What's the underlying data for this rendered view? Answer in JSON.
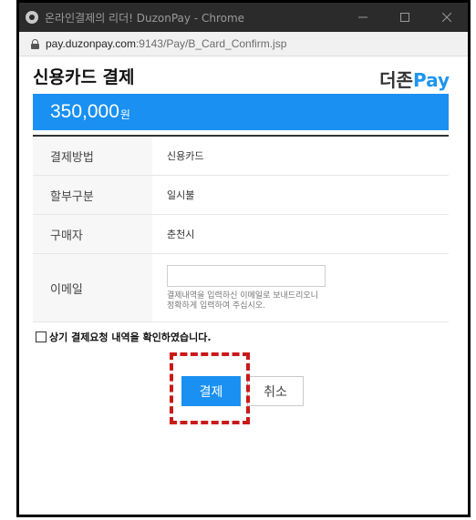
{
  "window": {
    "title": "온라인결제의 리더! DuzonPay - Chrome",
    "controls": {
      "minimize": "—",
      "maximize": "☐",
      "close": "✕"
    }
  },
  "url": {
    "host": "pay.duzonpay.com",
    "rest": ":9143/Pay/B_Card_Confirm.jsp"
  },
  "header": {
    "title": "신용카드 결제",
    "brand_korean": "더존",
    "brand_pay": "Pay"
  },
  "amount": {
    "value": "350,000",
    "unit": "원"
  },
  "details": {
    "rows": [
      {
        "label": "결제방법",
        "value": "신용카드"
      },
      {
        "label": "할부구분",
        "value": "일시불"
      },
      {
        "label": "구매자",
        "value": "춘천시"
      }
    ],
    "email": {
      "label": "이메일",
      "value": "",
      "placeholder": "",
      "help_line1": "결제내역을 입력하신 이메일로 보내드리오니",
      "help_line2": "정확하게 입력하여 주십시오."
    }
  },
  "confirm": {
    "text": "상기 결제요청 내역을 확인하였습니다.",
    "checked": false
  },
  "actions": {
    "pay_label": "결제",
    "cancel_label": "취소"
  },
  "colors": {
    "accent": "#1990f2",
    "highlight": "#c91919"
  }
}
